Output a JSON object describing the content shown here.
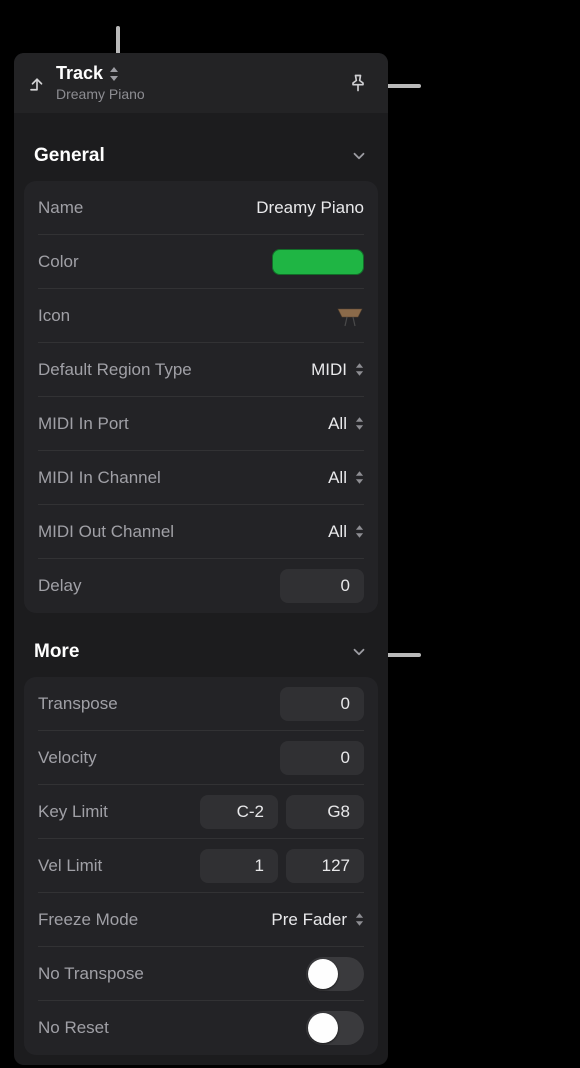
{
  "header": {
    "title": "Track",
    "subtitle": "Dreamy Piano"
  },
  "sections": {
    "general": {
      "title": "General",
      "name_label": "Name",
      "name_value": "Dreamy Piano",
      "color_label": "Color",
      "color_value": "#1fb544",
      "icon_label": "Icon",
      "region_type_label": "Default Region Type",
      "region_type_value": "MIDI",
      "midi_in_port_label": "MIDI In Port",
      "midi_in_port_value": "All",
      "midi_in_ch_label": "MIDI In Channel",
      "midi_in_ch_value": "All",
      "midi_out_ch_label": "MIDI Out Channel",
      "midi_out_ch_value": "All",
      "delay_label": "Delay",
      "delay_value": "0"
    },
    "more": {
      "title": "More",
      "transpose_label": "Transpose",
      "transpose_value": "0",
      "velocity_label": "Velocity",
      "velocity_value": "0",
      "key_limit_label": "Key Limit",
      "key_limit_low": "C-2",
      "key_limit_high": "G8",
      "vel_limit_label": "Vel Limit",
      "vel_limit_low": "1",
      "vel_limit_high": "127",
      "freeze_label": "Freeze Mode",
      "freeze_value": "Pre Fader",
      "no_transpose_label": "No Transpose",
      "no_reset_label": "No Reset"
    }
  }
}
